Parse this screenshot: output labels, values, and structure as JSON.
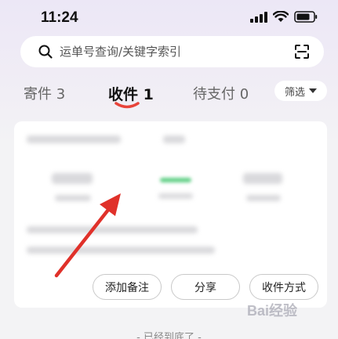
{
  "status_bar": {
    "time": "11:24"
  },
  "search": {
    "placeholder": "运单号查询/关键字索引"
  },
  "tabs": [
    {
      "label": "寄件 3"
    },
    {
      "label": "收件 1",
      "active": true
    },
    {
      "label": "待支付 0"
    }
  ],
  "filter": {
    "label": "筛选"
  },
  "card": {
    "actions": [
      {
        "label": "添加备注"
      },
      {
        "label": "分享"
      },
      {
        "label": "收件方式"
      }
    ]
  },
  "footer": {
    "end_text": "- 已经到底了 -"
  },
  "watermark": {
    "text": "Bai经验"
  },
  "colors": {
    "accent": "#e8443a",
    "annotation_arrow": "#e0312a",
    "progress_green": "#3cc46a"
  }
}
